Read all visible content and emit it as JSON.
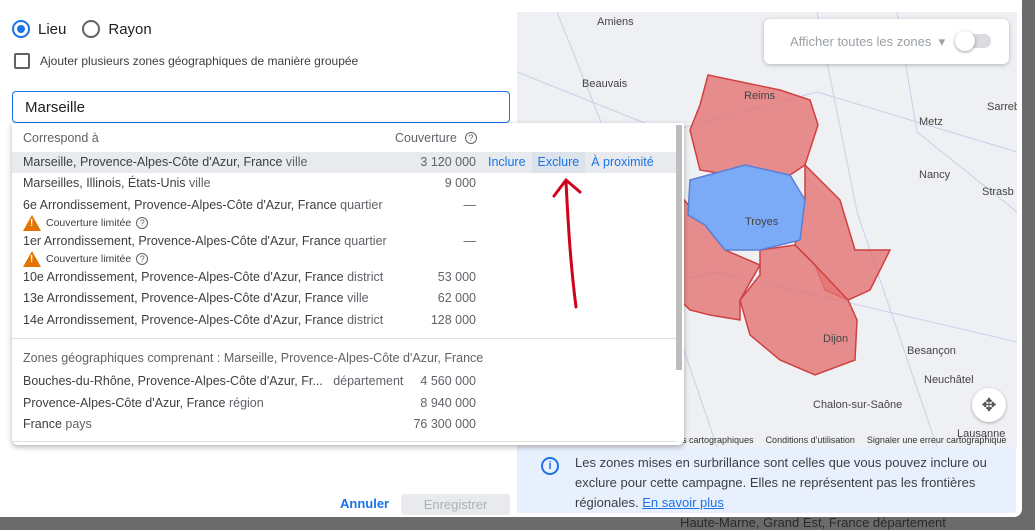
{
  "radio": {
    "lieu": "Lieu",
    "rayon": "Rayon",
    "selected": "Lieu"
  },
  "bulk_checkbox": "Ajouter plusieurs zones géographiques de manière groupée",
  "search": {
    "value": "Marseille"
  },
  "results": {
    "header_match": "Correspond à",
    "header_coverage": "Couverture",
    "rows": [
      {
        "name": "Marseille, Provence-Alpes-Côte d'Azur, France",
        "type": "ville",
        "coverage": "3 120 000"
      },
      {
        "name": "Marseilles, Illinois, États-Unis",
        "type": "ville",
        "coverage": "9 000"
      },
      {
        "name": "6e Arrondissement, Provence-Alpes-Côte d'Azur, France",
        "type": "quartier",
        "coverage": "—",
        "warning": "Couverture limitée"
      },
      {
        "name": "1er Arrondissement, Provence-Alpes-Côte d'Azur, France",
        "type": "quartier",
        "coverage": "—",
        "warning": "Couverture limitée"
      },
      {
        "name": "10e Arrondissement, Provence-Alpes-Côte d'Azur, France",
        "type": "district",
        "coverage": "53 000"
      },
      {
        "name": "13e Arrondissement, Provence-Alpes-Côte d'Azur, France",
        "type": "ville",
        "coverage": "62 000"
      },
      {
        "name": "14e Arrondissement, Provence-Alpes-Côte d'Azur, France",
        "type": "district",
        "coverage": "128 000"
      }
    ],
    "actions": {
      "include": "Inclure",
      "exclude": "Exclure",
      "nearby": "À proximité"
    },
    "section_title": "Zones géographiques comprenant : Marseille, Provence-Alpes-Côte d'Azur, France",
    "parents": [
      {
        "name": "Bouches-du-Rhône, Provence-Alpes-Côte d'Azur, Fr...",
        "type": "département",
        "coverage": "4 560 000"
      },
      {
        "name": "Provence-Alpes-Côte d'Azur, France",
        "type": "région",
        "coverage": "8 940 000"
      },
      {
        "name": "France",
        "type": "pays",
        "coverage": "76 300 000"
      }
    ]
  },
  "map": {
    "show_all_label": "Afficher toutes les zones",
    "cities": [
      "Amiens",
      "Beauvais",
      "Reims",
      "Metz",
      "Nancy",
      "Troyes",
      "Dijon",
      "Besançon",
      "Chalon-sur-Saône",
      "Lausanne",
      "Neuchâtel",
      "Strasb",
      "Sarreb"
    ],
    "attribution": [
      "es cartographiques",
      "Conditions d'utilisation",
      "Signaler une erreur cartographique"
    ],
    "colors": {
      "excluded": "#e57373",
      "included": "#7baaf7"
    }
  },
  "info": {
    "text": "Les zones mises en surbrillance sont celles que vous pouvez inclure ou exclure pour cette campagne. Elles ne représentent pas les frontières régionales.",
    "link": "En savoir plus"
  },
  "footer": {
    "cancel": "Annuler",
    "save": "Enregistrer"
  },
  "background_text": "Haute-Marne, Grand Est, France département"
}
